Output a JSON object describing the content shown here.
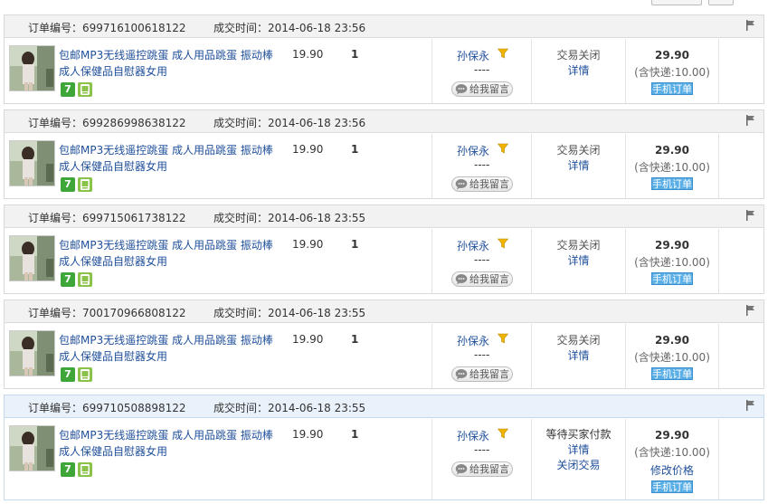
{
  "labels": {
    "order_no": "订单编号：",
    "deal_time": "成交时间：",
    "leave_message": "给我留言",
    "mobile_order": "手机订单"
  },
  "icons": {
    "flag": "flag-icon",
    "filter": "funnel-icon",
    "message": "speech-bubble-icon",
    "seven_day": "seven-day-return-icon",
    "mobile": "mobile-phone-icon"
  },
  "colors": {
    "link": "#1f4f9a",
    "mobile_badge": "#5aaee6",
    "seven_badge": "#3fa63a",
    "pending_header": "#e9f1fa"
  },
  "orders": [
    {
      "order_no": "699716100618122",
      "time": "2014-06-18 23:56",
      "title": "包邮MP3无线遥控跳蛋 成人用品跳蛋 振动棒成人保健品自慰器女用",
      "price": "19.90",
      "qty": "1",
      "buyer": "孙保永",
      "dashes": "----",
      "status": "交易关闭",
      "details": "详情",
      "close": "",
      "total": "29.90",
      "shipping": "(含快递:10.00)",
      "modify": ""
    },
    {
      "order_no": "699286998638122",
      "time": "2014-06-18 23:56",
      "title": "包邮MP3无线遥控跳蛋 成人用品跳蛋 振动棒成人保健品自慰器女用",
      "price": "19.90",
      "qty": "1",
      "buyer": "孙保永",
      "dashes": "----",
      "status": "交易关闭",
      "details": "详情",
      "close": "",
      "total": "29.90",
      "shipping": "(含快递:10.00)",
      "modify": ""
    },
    {
      "order_no": "699715061738122",
      "time": "2014-06-18 23:55",
      "title": "包邮MP3无线遥控跳蛋 成人用品跳蛋 振动棒成人保健品自慰器女用",
      "price": "19.90",
      "qty": "1",
      "buyer": "孙保永",
      "dashes": "----",
      "status": "交易关闭",
      "details": "详情",
      "close": "",
      "total": "29.90",
      "shipping": "(含快递:10.00)",
      "modify": ""
    },
    {
      "order_no": "700170966808122",
      "time": "2014-06-18 23:55",
      "title": "包邮MP3无线遥控跳蛋 成人用品跳蛋 振动棒成人保健品自慰器女用",
      "price": "19.90",
      "qty": "1",
      "buyer": "孙保永",
      "dashes": "----",
      "status": "交易关闭",
      "details": "详情",
      "close": "",
      "total": "29.90",
      "shipping": "(含快递:10.00)",
      "modify": ""
    },
    {
      "order_no": "699710508898122",
      "time": "2014-06-18 23:55",
      "title": "包邮MP3无线遥控跳蛋 成人用品跳蛋 振动棒成人保健品自慰器女用",
      "price": "19.90",
      "qty": "1",
      "buyer": "孙保永",
      "dashes": "----",
      "status": "等待买家付款",
      "details": "详情",
      "close": "关闭交易",
      "total": "29.90",
      "shipping": "(含快递:10.00)",
      "modify": "修改价格"
    }
  ]
}
